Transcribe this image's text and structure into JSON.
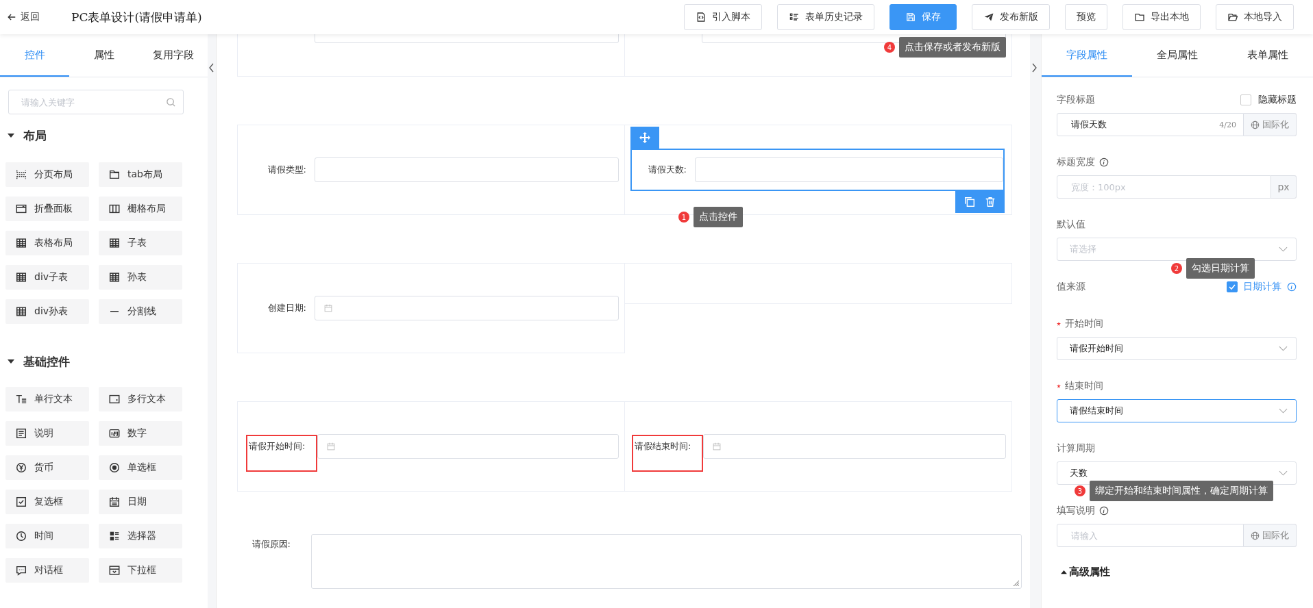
{
  "header": {
    "back": "返回",
    "title": "PC表单设计(请假申请单)",
    "buttons": [
      {
        "label": "引入脚本",
        "primary": false
      },
      {
        "label": "表单历史记录",
        "primary": false
      },
      {
        "label": "保存",
        "primary": true
      },
      {
        "label": "发布新版",
        "primary": false
      },
      {
        "label": "预览",
        "primary": false
      },
      {
        "label": "导出本地",
        "primary": false
      },
      {
        "label": "本地导入",
        "primary": false
      }
    ]
  },
  "left_panel": {
    "tabs": [
      {
        "label": "控件",
        "selected": true
      },
      {
        "label": "属性",
        "selected": false
      },
      {
        "label": "复用字段",
        "selected": false
      }
    ],
    "search": {
      "placeholder": "请输入关键字"
    },
    "groups": [
      {
        "title": "布局",
        "expanded": true,
        "items": [
          {
            "label": "分页布局"
          },
          {
            "label": "tab布局"
          },
          {
            "label": "折叠面板"
          },
          {
            "label": "栅格布局"
          },
          {
            "label": "表格布局"
          },
          {
            "label": "子表"
          },
          {
            "label": "div子表"
          },
          {
            "label": "孙表"
          },
          {
            "label": "div孙表"
          },
          {
            "label": "分割线"
          }
        ]
      },
      {
        "title": "基础控件",
        "expanded": true,
        "items": [
          {
            "label": "单行文本"
          },
          {
            "label": "多行文本"
          },
          {
            "label": "说明"
          },
          {
            "label": "数字"
          },
          {
            "label": "货币"
          },
          {
            "label": "单选框"
          },
          {
            "label": "复选框"
          },
          {
            "label": "日期"
          },
          {
            "label": "时间"
          },
          {
            "label": "选择器"
          },
          {
            "label": "对话框"
          },
          {
            "label": "下拉框"
          }
        ]
      }
    ]
  },
  "canvas": {
    "rows": [
      {
        "cells": [
          {
            "kind": "input"
          },
          {
            "kind": "input"
          }
        ]
      },
      {
        "cells": [
          {
            "kind": "input",
            "label": "请假类型:",
            "selected": false,
            "highlighted": false
          },
          {
            "kind": "input",
            "label": "请假天数:",
            "selected": true,
            "highlighted": false
          }
        ]
      },
      {
        "cells": [
          {
            "kind": "date",
            "label": "创建日期:",
            "selected": false,
            "highlighted": false
          },
          {
            "kind": "empty"
          }
        ]
      },
      {
        "cells": [
          {
            "kind": "date",
            "label": "请假开始时间:",
            "selected": false,
            "highlighted": true
          },
          {
            "kind": "date",
            "label": "请假结束时间:",
            "selected": false,
            "highlighted": true
          }
        ]
      }
    ],
    "textarea": {
      "label": "请假原因:"
    }
  },
  "right_panel": {
    "tabs": [
      {
        "label": "字段属性",
        "selected": true
      },
      {
        "label": "全局属性",
        "selected": false
      },
      {
        "label": "表单属性",
        "selected": false
      }
    ],
    "properties": [
      {
        "kind": "text",
        "label": "字段标题",
        "value": "请假天数",
        "counter": "4/20",
        "addon": {
          "label": "国际化",
          "kind": "globe"
        },
        "toggle": {
          "label": "隐藏标题",
          "checked": false
        }
      },
      {
        "kind": "text",
        "label": "标题宽度",
        "info": true,
        "placeholder": "宽度：100px",
        "addon": {
          "label": "px",
          "kind": "plain"
        }
      },
      {
        "kind": "select",
        "label": "默认值",
        "placeholder": "请选择",
        "focused": false
      },
      {
        "kind": "check",
        "label": "值来源",
        "option": {
          "label": "日期计算",
          "checked": true
        }
      },
      {
        "kind": "select",
        "label": "开始时间",
        "value": "请假开始时间",
        "required": true,
        "focused": false
      },
      {
        "kind": "select",
        "label": "结束时间",
        "value": "请假结束时间",
        "required": true,
        "focused": true
      },
      {
        "kind": "select",
        "label": "计算周期",
        "value": "天数",
        "focused": false
      },
      {
        "kind": "text",
        "label": "填写说明",
        "info": true,
        "placeholder": "请输入",
        "addon": {
          "label": "国际化",
          "kind": "globe"
        }
      }
    ],
    "advanced": {
      "label": "高级属性",
      "expanded": false
    }
  },
  "annotations": [
    {
      "number": "4",
      "text": "点击保存或者发布新版"
    },
    {
      "number": "1",
      "text": "点击控件"
    },
    {
      "number": "2",
      "text": "勾选日期计算"
    },
    {
      "number": "3",
      "text": "绑定开始和结束时间属性，确定周期计算"
    }
  ]
}
